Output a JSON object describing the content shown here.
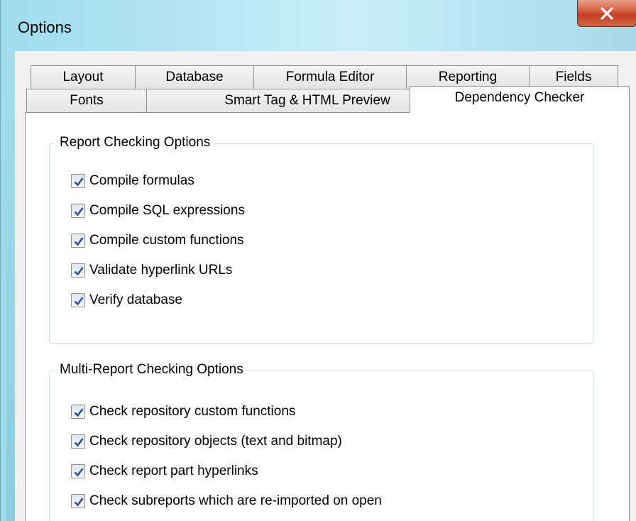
{
  "window": {
    "title": "Options",
    "close_glyph": "X"
  },
  "tabs": {
    "row_back": [
      "Layout",
      "Database",
      "Formula Editor",
      "Reporting",
      "Fields"
    ],
    "row_front": [
      "Fonts",
      "Smart Tag & HTML Preview",
      "Dependency Checker"
    ],
    "active": "Dependency Checker"
  },
  "groups": [
    {
      "label": "Report Checking Options",
      "options": [
        {
          "label": "Compile formulas",
          "checked": true
        },
        {
          "label": "Compile SQL expressions",
          "checked": true
        },
        {
          "label": "Compile custom functions",
          "checked": true
        },
        {
          "label": "Validate hyperlink URLs",
          "checked": true
        },
        {
          "label": "Verify database",
          "checked": true
        }
      ]
    },
    {
      "label": "Multi-Report Checking Options",
      "options": [
        {
          "label": "Check repository custom functions",
          "checked": true
        },
        {
          "label": "Check repository objects (text and bitmap)",
          "checked": true
        },
        {
          "label": "Check report part hyperlinks",
          "checked": true
        },
        {
          "label": "Check subreports which are re-imported on open",
          "checked": true
        }
      ]
    }
  ],
  "colors": {
    "check_mark": "#2b4f9a",
    "group_border": "#d5dfe5"
  }
}
